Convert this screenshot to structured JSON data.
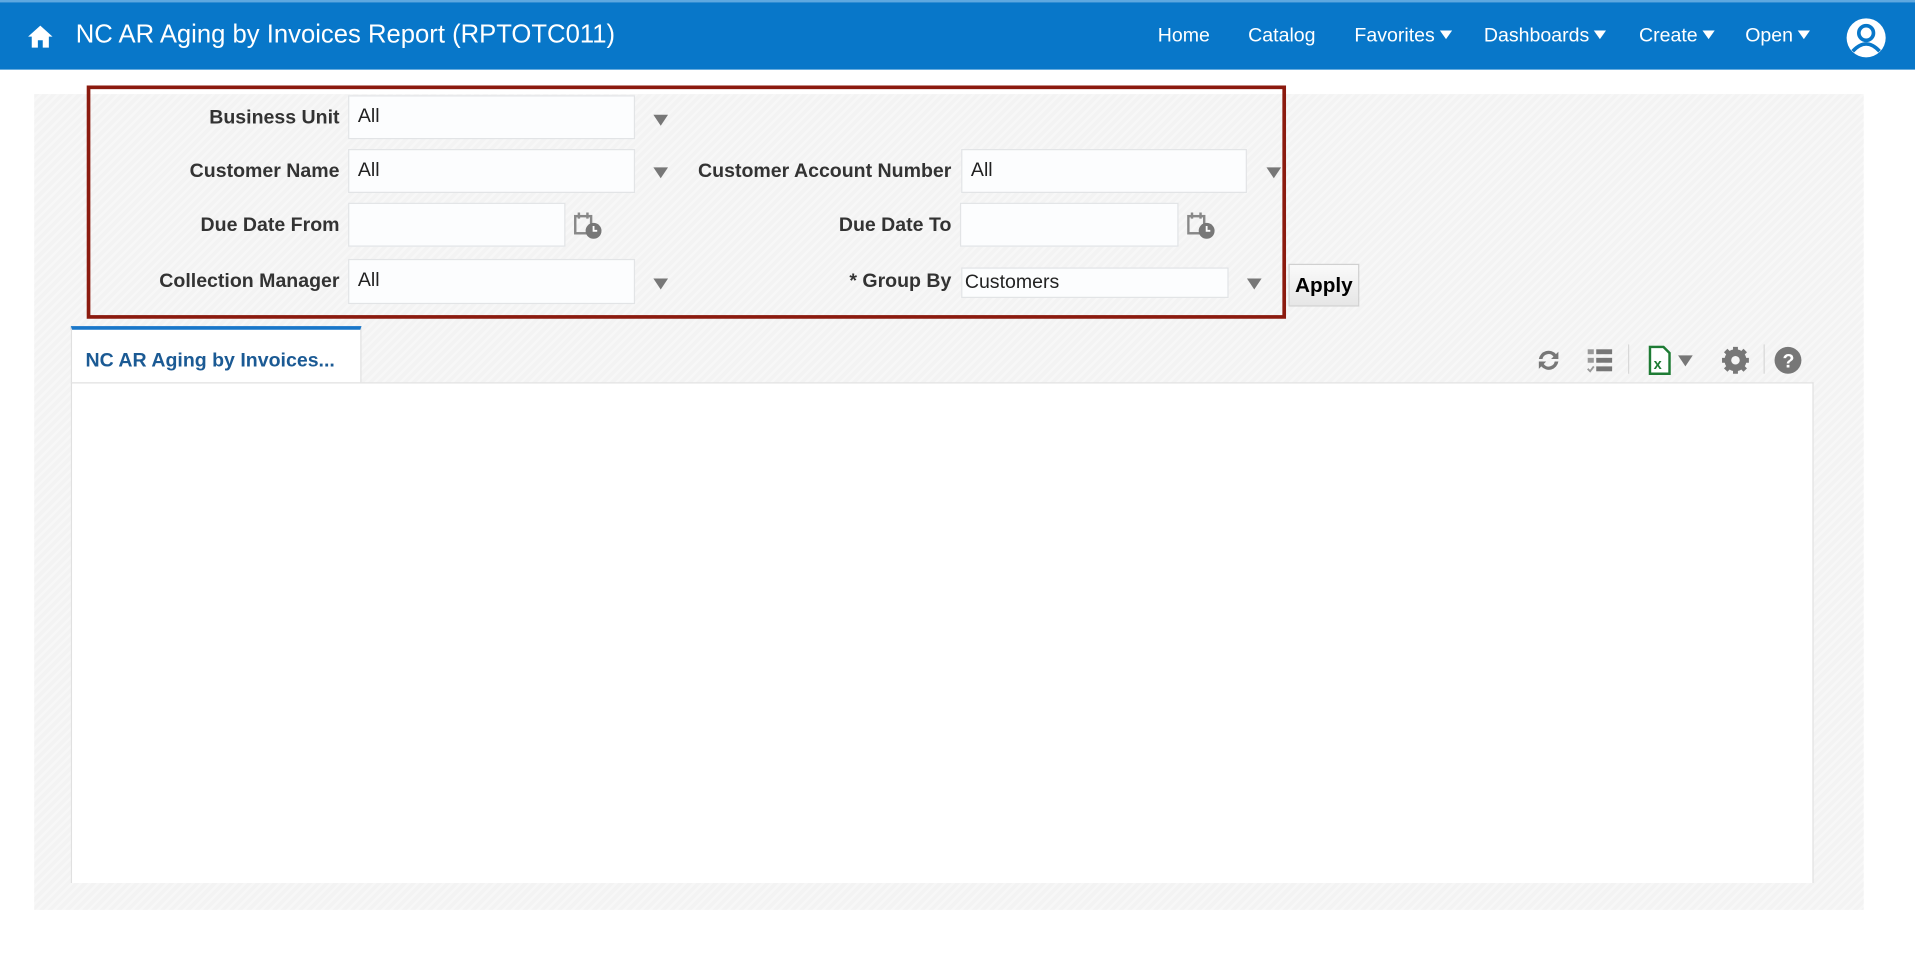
{
  "header": {
    "title": "NC AR Aging by Invoices Report (RPTOTC011)",
    "nav": [
      "Home",
      "Catalog",
      "Favorites",
      "Dashboards",
      "Create",
      "Open"
    ]
  },
  "prompts": {
    "business_unit": {
      "label": "Business Unit",
      "value": "All"
    },
    "customer_name": {
      "label": "Customer Name",
      "value": "All"
    },
    "customer_account_number": {
      "label": "Customer Account Number",
      "value": "All"
    },
    "due_date_from": {
      "label": "Due Date From",
      "value": ""
    },
    "due_date_to": {
      "label": "Due Date To",
      "value": ""
    },
    "collection_manager": {
      "label": "Collection Manager",
      "value": "All"
    },
    "group_by": {
      "label": "* Group By",
      "value": "Customers"
    },
    "apply_label": "Apply"
  },
  "tab": {
    "label": "NC AR Aging by Invoices..."
  },
  "colors": {
    "header": "#0877c9",
    "highlight_box": "#8b1a0e",
    "excel": "#1e7b34"
  }
}
